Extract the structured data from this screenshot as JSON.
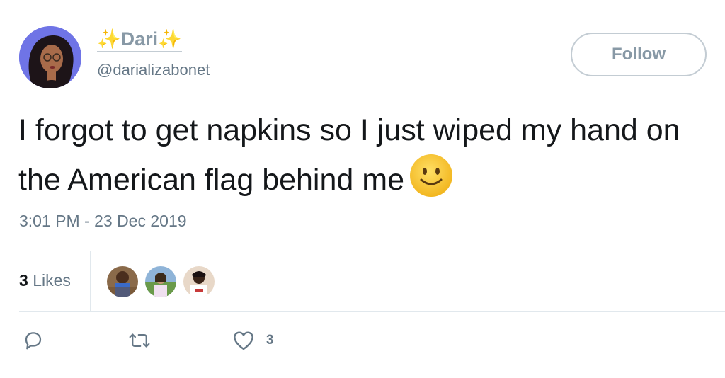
{
  "user": {
    "display_name": "Dari",
    "sparkle_left": "✨",
    "sparkle_right": "✨",
    "handle": "@darializabonet",
    "avatar_color": "#6f74e6"
  },
  "follow_button": {
    "label": "Follow"
  },
  "tweet": {
    "text": "I forgot to get napkins so I just wiped my hand on the American flag behind me",
    "emoji": "slightly-smiling-face-icon",
    "timestamp": "3:01 PM - 23 Dec 2019"
  },
  "stats": {
    "likes_count": "3",
    "likes_label": "Likes"
  },
  "likers": [
    {
      "name": "liker-avatar-1"
    },
    {
      "name": "liker-avatar-2"
    },
    {
      "name": "liker-avatar-3"
    }
  ],
  "actions": {
    "reply_icon": "reply-icon",
    "retweet_icon": "retweet-icon",
    "like_icon": "heart-icon",
    "like_count": "3"
  },
  "colors": {
    "text": "#14171a",
    "muted": "#657786",
    "border": "#e1e8ed",
    "follow_border": "#c3ccd3"
  }
}
